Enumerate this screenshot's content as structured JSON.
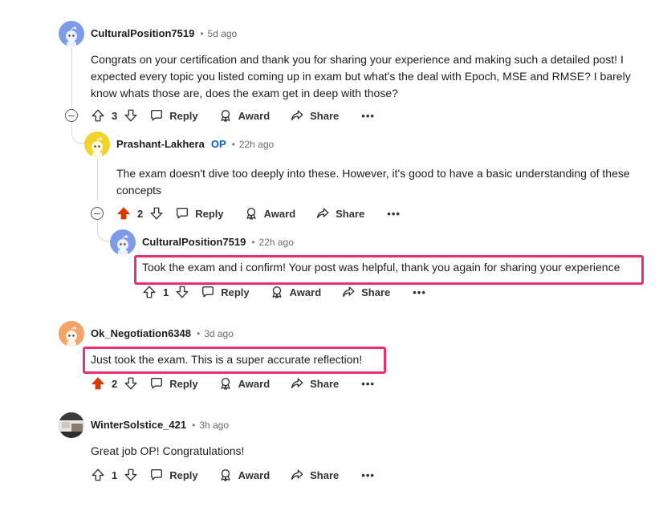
{
  "comments": [
    {
      "user": "CulturalPosition7519",
      "time": "5d ago",
      "text": "Congrats on your certification and thank you for sharing your experience and making such a detailed post! I expected every topic you listed coming up in exam but what's the deal with Epoch, MSE and RMSE? I barely know whats those are, does the exam get in deep with those?",
      "votes": "3",
      "avatar_color": "#7e9bea"
    },
    {
      "user": "Prashant-Lakhera",
      "op_badge": "OP",
      "time": "22h ago",
      "text": "The exam doesn't dive too deeply into these. However, it's good to have a basic understanding of these concepts",
      "votes": "2",
      "avatar_color": "#f2d32b"
    },
    {
      "user": "CulturalPosition7519",
      "time": "22h ago",
      "text": "Took the exam and i confirm! Your post was helpful, thank you again for sharing your experience",
      "votes": "1",
      "avatar_color": "#7e9bea"
    },
    {
      "user": "Ok_Negotiation6348",
      "time": "3d ago",
      "text": "Just took the exam. This is a super accurate reflection!",
      "votes": "2",
      "avatar_color": "#f4a367"
    },
    {
      "user": "WinterSolstice_421",
      "time": "3h ago",
      "text": "Great job OP! Congratulations!",
      "votes": "1",
      "avatar_color": "#5b5b5b"
    }
  ],
  "actions": {
    "reply": "Reply",
    "award": "Award",
    "share": "Share",
    "more": "•••"
  },
  "meta_separator": "•",
  "colors": {
    "upvote_active": "#d93a00",
    "op_badge": "#0a5dd6",
    "highlight": "#ec2f6b",
    "thread_line": "#d5d7da"
  },
  "icons": [
    "upvote-icon",
    "downvote-icon",
    "reply-icon",
    "award-icon",
    "share-icon",
    "collapse-icon"
  ]
}
